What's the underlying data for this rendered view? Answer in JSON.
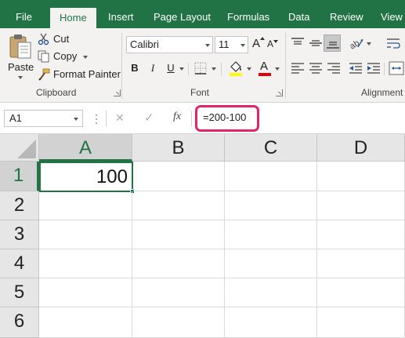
{
  "tabs": [
    "File",
    "Home",
    "Insert",
    "Page Layout",
    "Formulas",
    "Data",
    "Review",
    "View"
  ],
  "active_tab": "Home",
  "accent_color": "#217346",
  "highlight_color": "#e3246a",
  "clipboard": {
    "paste_label": "Paste",
    "cut_label": "Cut",
    "copy_label": "Copy",
    "format_painter_label": "Format Painter",
    "group_label": "Clipboard"
  },
  "font": {
    "font_name": "Calibri",
    "font_size": "11",
    "bold": "B",
    "italic": "I",
    "underline": "U",
    "font_color_letter": "A",
    "font_grow_letter": "A",
    "font_shrink_letter": "A",
    "group_label": "Font"
  },
  "alignment": {
    "group_label": "Alignment"
  },
  "formula_bar": {
    "name_box": "A1",
    "cancel": "✕",
    "enter": "✓",
    "fx": "fx",
    "formula": "=200-100"
  },
  "columns": [
    "A",
    "B",
    "C",
    "D"
  ],
  "rows": [
    "1",
    "2",
    "3",
    "4",
    "5",
    "6"
  ],
  "cells": {
    "A1": "100"
  },
  "selected_cell": "A1"
}
